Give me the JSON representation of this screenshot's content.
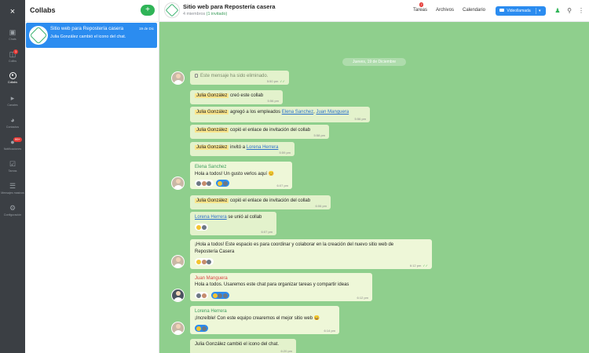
{
  "rail": {
    "close": "×",
    "items": [
      {
        "label": "Chats",
        "icon": "chats-icon"
      },
      {
        "label": "Collbs",
        "icon": "collabs-icon",
        "badge": "1"
      },
      {
        "label": "Collabs",
        "icon": "collab-circle-icon",
        "active": true
      },
      {
        "label": "Canales",
        "icon": "megaphone-icon"
      },
      {
        "label": "Contactos",
        "icon": "contacts-icon"
      },
      {
        "label": "Notificaciones",
        "icon": "bell-icon",
        "badge": "99+"
      },
      {
        "label": "Tareas",
        "icon": "tasks-icon"
      },
      {
        "label": "Mensajes masivos",
        "icon": "bars-icon"
      },
      {
        "label": "Configuración",
        "icon": "gear-icon"
      }
    ]
  },
  "list": {
    "title": "Collabs",
    "add": "+",
    "conversation": {
      "name": "Sitio web para Repostería casera",
      "date": "19 de Dic",
      "preview": "Julia González cambió el icono del chat."
    }
  },
  "header": {
    "title": "Sitio web para Repostería casera",
    "members": "4 miembros",
    "invited": "(1 invitado)",
    "nav": {
      "tasks": "Tareas",
      "tasks_badge": "2",
      "files": "Archivos",
      "calendar": "Calendario"
    },
    "video_button": "Videollamada",
    "caret": "▾"
  },
  "chat": {
    "date_separator": "Jueves, 19 de Diciembre",
    "messages": [
      {
        "text": "Este mensaje ha sido eliminado.",
        "time": "5:50 pm"
      },
      {
        "mention": "Julia González",
        "text": "creó este collab",
        "time": "5:56 pm"
      },
      {
        "mention": "Julia González",
        "text": "agregó a los empleados",
        "link1": "Elena Sanchez",
        "sep": ",",
        "link2": "Juan Manguera",
        "time": "5:56 pm"
      },
      {
        "mention": "Julia González",
        "text": "copió el enlace de invitación del collab",
        "time": "5:58 pm"
      },
      {
        "mention": "Julia González",
        "text": "invitó a",
        "link1": "Lorena Herrera",
        "time": "5:59 pm"
      },
      {
        "sender": "Elena Sanchez",
        "text": "Hola a todos! Un gusto verlos aquí 😊",
        "time": "6:07 pm"
      },
      {
        "mention": "Julia González",
        "text": "copió el enlace de invitación del collab",
        "time": "6:06 pm"
      },
      {
        "link1": "Lorena Herrera",
        "text": "se unió al collab",
        "time": "6:07 pm"
      },
      {
        "line1": "¡Hola a todos! Este espacio es para coordinar y colaborar en la creación del nuevo sitio web de",
        "line2": "Repostería Casera",
        "time": "6:12 pm"
      },
      {
        "sender": "Juan Manguera",
        "text": "Hola a todos. Usaremos este chat para organizar tareas y compartir ideas",
        "time": "6:12 pm"
      },
      {
        "sender": "Lorena Herrera",
        "text": "¡Increíble! Con este equipo crearemos el mejor sitio web 😄",
        "time": "6:14 pm"
      },
      {
        "text": "Julia González cambió el icono del chat.",
        "time": "6:20 pm"
      }
    ]
  }
}
